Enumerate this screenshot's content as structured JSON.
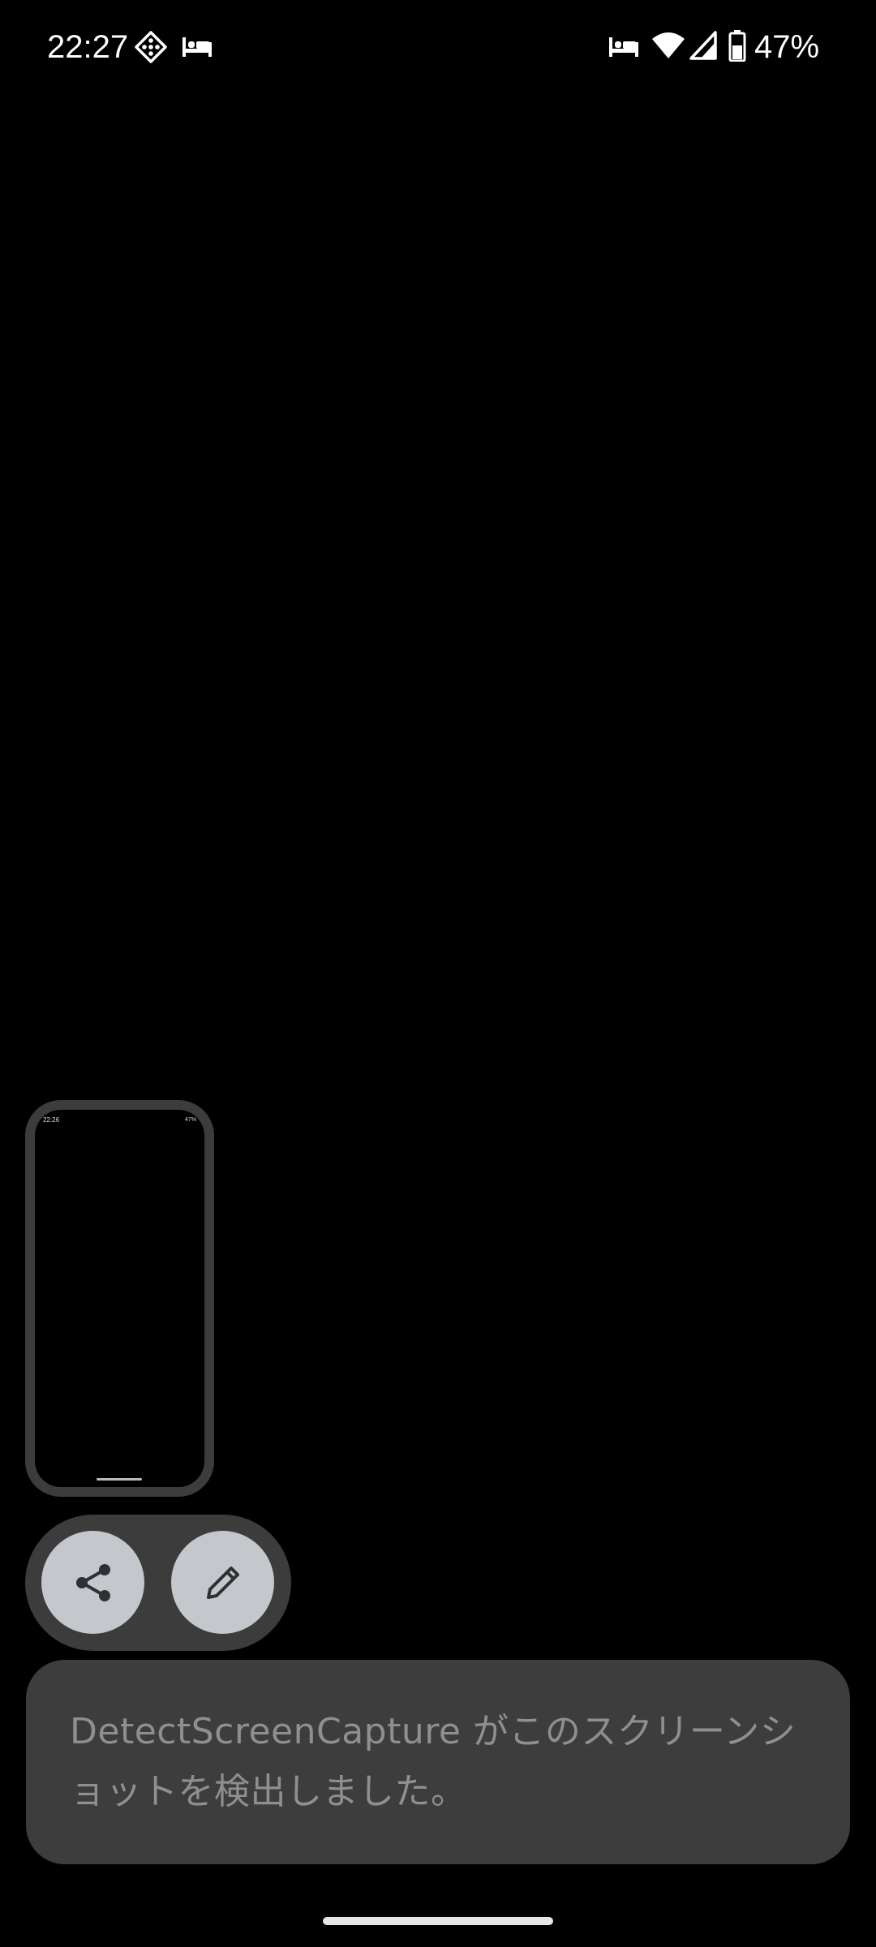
{
  "status_bar": {
    "time": "22:27",
    "battery_percent": "47%",
    "icons": [
      "assistant-icon",
      "bed-icon",
      "bed-icon",
      "wifi-icon",
      "signal-icon",
      "battery-icon"
    ]
  },
  "preview": {
    "mini_time": "22:26",
    "mini_battery": "47%"
  },
  "actions": {
    "share_icon": "share-icon",
    "edit_icon": "edit-pencil-icon"
  },
  "toast": {
    "message": "DetectScreenCapture がこのスクリーンショットを検出しました。"
  },
  "colors": {
    "background": "#000000",
    "pill_background": "#3c3c3c",
    "button_fill": "#c4c7cc",
    "toast_background": "#3d3d3d",
    "toast_text": "#8f8f8f"
  }
}
